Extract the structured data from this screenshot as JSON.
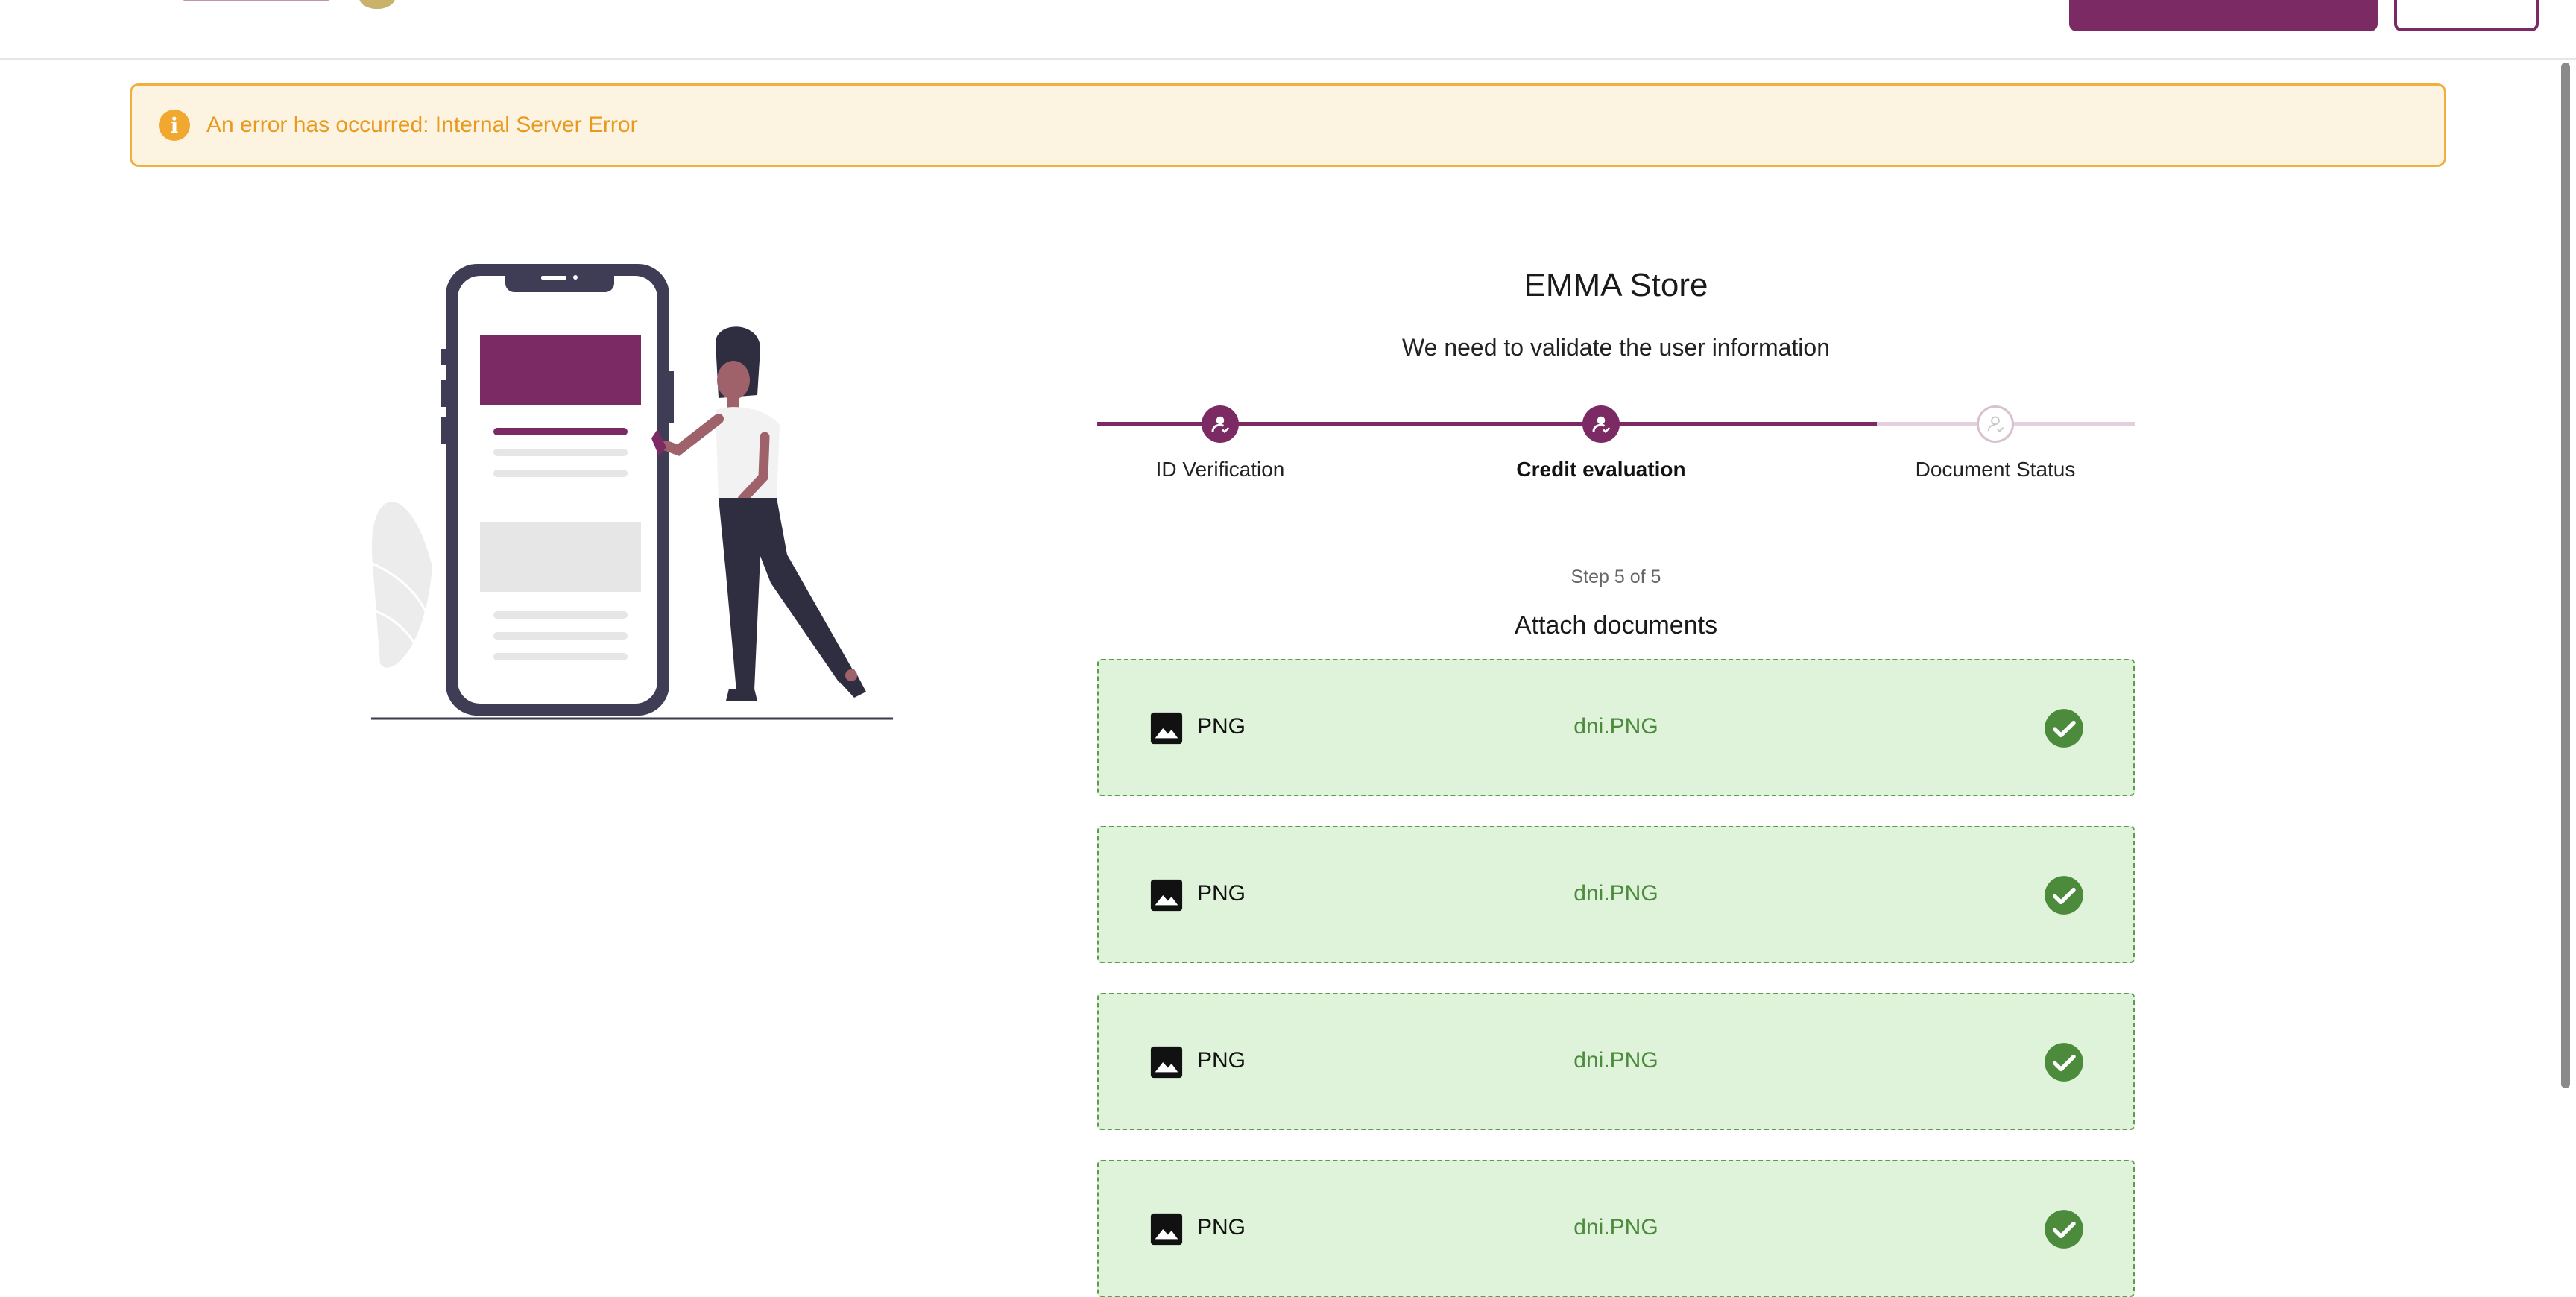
{
  "alert": {
    "icon": "info-icon",
    "message": "An error has occurred: Internal Server Error",
    "color": "#e89a20"
  },
  "header": {
    "accent": "#7b2a63"
  },
  "main": {
    "title": "EMMA Store",
    "subtitle": "We need to validate the user information",
    "steps": [
      {
        "label": "ID Verification",
        "status": "completed",
        "icon": "user-check-icon"
      },
      {
        "label": "Credit evaluation",
        "status": "current",
        "icon": "user-check-icon"
      },
      {
        "label": "Document Status",
        "status": "pending",
        "icon": "user-check-icon"
      }
    ],
    "step_counter": "Step 5 of 5",
    "section_title": "Attach documents",
    "documents": [
      {
        "type": "PNG",
        "name": "dni.PNG",
        "status": "uploaded"
      },
      {
        "type": "PNG",
        "name": "dni.PNG",
        "status": "uploaded"
      },
      {
        "type": "PNG",
        "name": "dni.PNG",
        "status": "uploaded"
      },
      {
        "type": "PNG",
        "name": "dni.PNG",
        "status": "uploaded"
      }
    ]
  },
  "colors": {
    "accent": "#7b2a63",
    "success": "#4c8a3c",
    "success_bg": "#dff3da",
    "warning_bg": "#fdf3e1"
  }
}
